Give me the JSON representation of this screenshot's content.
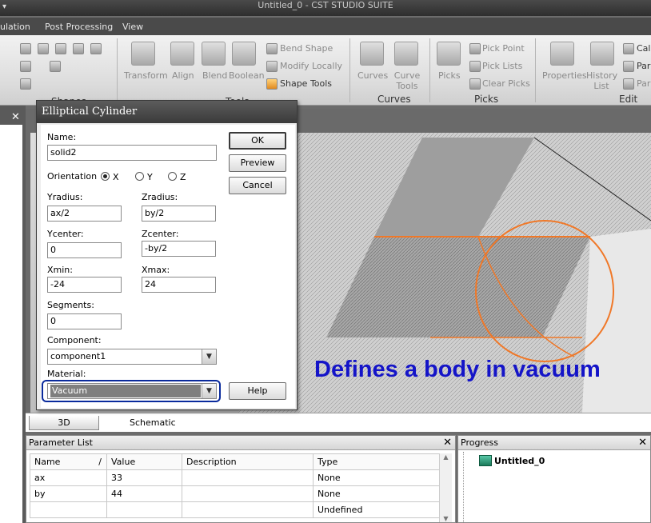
{
  "window": {
    "title": "Untitled_0 - CST STUDIO SUITE",
    "system_menu": "▾"
  },
  "menu_tabs": [
    "ulation",
    "Post Processing",
    "View"
  ],
  "ribbon": {
    "shapes_group": "Shapes",
    "tools_buttons": [
      "Transform",
      "Align",
      "Blend",
      "Boolean"
    ],
    "tools_list": [
      "Bend Shape",
      "Modify Locally",
      "Shape Tools"
    ],
    "tools_group": "Tools",
    "curves_buttons": [
      "Curves",
      "Curve Tools"
    ],
    "curves_group": "Curves",
    "picks_button": "Picks",
    "picks_list": [
      "Pick Point",
      "Pick Lists",
      "Clear Picks"
    ],
    "picks_group": "Picks",
    "edit_buttons": [
      "Properties",
      "History List"
    ],
    "edit_list": [
      "Calc",
      "Par",
      "Par"
    ],
    "edit_group": "Edit"
  },
  "dialog": {
    "title": "Elliptical Cylinder",
    "name_label": "Name:",
    "name_value": "solid2",
    "orientation_label": "Orientation",
    "orientation_options": [
      "X",
      "Y",
      "Z"
    ],
    "orientation_selected": "X",
    "yradius_label": "Yradius:",
    "yradius_value": "ax/2",
    "zradius_label": "Zradius:",
    "zradius_value": "by/2",
    "ycenter_label": "Ycenter:",
    "ycenter_value": "0",
    "zcenter_label": "Zcenter:",
    "zcenter_value": "-by/2",
    "xmin_label": "Xmin:",
    "xmin_value": "-24",
    "xmax_label": "Xmax:",
    "xmax_value": "24",
    "segments_label": "Segments:",
    "segments_value": "0",
    "component_label": "Component:",
    "component_value": "component1",
    "material_label": "Material:",
    "material_value": "Vacuum",
    "ok_label": "OK",
    "preview_label": "Preview",
    "cancel_label": "Cancel",
    "help_label": "Help"
  },
  "view": {
    "annotation": "Defines a body in vacuum",
    "tabs": [
      "3D",
      "Schematic"
    ],
    "highlight_color": "#f07828"
  },
  "parameter_list": {
    "title": "Parameter List",
    "columns": [
      "Name",
      "/",
      "Value",
      "Description",
      "Type"
    ],
    "rows": [
      {
        "name": "ax",
        "value": "33",
        "description": "",
        "type": "None"
      },
      {
        "name": "by",
        "value": "44",
        "description": "",
        "type": "None"
      },
      {
        "name": "",
        "value": "",
        "description": "",
        "type": "Undefined"
      }
    ]
  },
  "progress": {
    "title": "Progress",
    "item": "Untitled_0"
  }
}
